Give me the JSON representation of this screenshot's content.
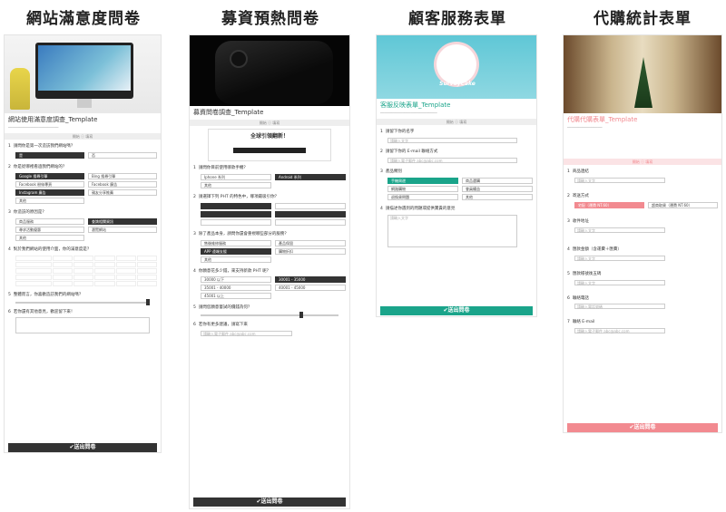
{
  "columns": [
    {
      "heading": "網站滿意度問卷",
      "form_title": "網站使用滿意度調查_Template",
      "submit": "✔送出問卷"
    },
    {
      "heading": "募資預熱問卷",
      "form_title": "募資問卷調查_Template",
      "submit": "✔送出問卷"
    },
    {
      "heading": "顧客服務表單",
      "form_title": "客服反映表單_Template",
      "submit": "✔送出問卷"
    },
    {
      "heading": "代購統計表單",
      "form_title": "代購代購表單_Template",
      "submit": "✔送出問卷"
    }
  ],
  "survey1": {
    "bar": "開始 ⓘ 填寫",
    "q1": "請問你是第一次造訪我們網站嗎？",
    "q1_a": "是",
    "q1_b": "否",
    "q2": "你是從哪裡看過我們網站的？",
    "q2_opts": [
      "Google 搜尋引擎",
      "Bing 搜尋引擎",
      "Facebook 粉絲專頁",
      "Facebook 廣告",
      "Instagram 廣告",
      "親友分享推薦",
      "其他"
    ],
    "q3": "你造訪的原因是？",
    "q3_opts": [
      "商品服務",
      "查詢相關資訊",
      "尋求活動優惠",
      "瀏覽網站",
      "其他"
    ],
    "q4": "對於我們網站的使用介面，你的滿意度是？",
    "q5": "整體而言，你喜歡造訪我們的網站嗎？",
    "q6": "若你還有其他意見，歡迎留下來！"
  },
  "survey2": {
    "bar": "開始 ⓘ 填寫",
    "headline": "全球引領翻新！",
    "q1": "請問你目前使用哪款手機？",
    "q1_opts": [
      "Iphone 系列",
      "Android 系列",
      "其他"
    ],
    "q2": "請選擇下列 PHT 的特色中，哪項最吸引你？",
    "q3": "除了產品本身，請問你還會重視哪些部分的服務？",
    "q3_opts": [
      "售後維修服務",
      "產品保固",
      "APP 遠端支援",
      "購物折扣",
      "其他"
    ],
    "q4": "你願意花多少錢，來支持新款 PHT 呢？",
    "q4_opts": [
      "30000 以下",
      "30001 - 35000",
      "35001 - 40000",
      "40001 - 45000",
      "45001 以上"
    ],
    "q5": "請問您願意嘗試的價錢為何？",
    "q6": "若你有更多建議，請寫下來",
    "placeholder": "請輸入電子郵件 abc@abc.com"
  },
  "survey3": {
    "bar": "開始 ⓘ 填寫",
    "logo": "SurveyCake",
    "q1": "請留下你的名字",
    "q1_ph": "請輸入文字",
    "q2": "請留下你的 E-mail 聯絡方式",
    "q2_ph": "請輸入電子郵件 abc@abc.com",
    "q3": "產品類別",
    "q3_opts": [
      "手機周邊",
      "商品選購",
      "網路購物",
      "會員權益",
      "退換貨問題",
      "其他"
    ],
    "q4": "請描述你遇到的問題或提供寶貴的意見",
    "q4_ph": "請輸入文字"
  },
  "survey4": {
    "bar": "開始 ⓘ 填寫",
    "q1": "商品連結",
    "q1_ph": "請輸入文字",
    "q2": "寄送方式",
    "q2_opts": [
      "宅配（運費 NT.60）",
      "超商取貨（運費 NT.60）"
    ],
    "q3": "收件地址",
    "q3_ph": "請輸入文字",
    "q4": "匯款金額（含運費＋匯費）",
    "q4_ph": "請輸入文字",
    "q5": "匯款帳號後五碼",
    "q5_ph": "請輸入文字",
    "q6": "聯絡電話",
    "q6_ph": "請輸入電話號碼",
    "q7": "聯絡 E-mail",
    "q7_ph": "請輸入電子郵件 abc@abc.com"
  },
  "colors": {
    "dark": "#333333",
    "teal": "#1aa48a",
    "pink": "#f28a90"
  }
}
